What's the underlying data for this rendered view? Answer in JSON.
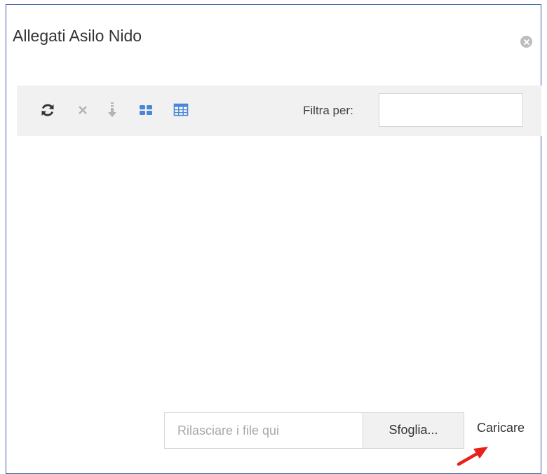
{
  "dialog": {
    "title": "Allegati Asilo Nido",
    "close_icon": "close-circle-icon"
  },
  "toolbar": {
    "icons": [
      "refresh-icon",
      "delete-icon",
      "download-icon",
      "thumbnail-view-icon",
      "grid-view-icon"
    ],
    "filter_label": "Filtra per:",
    "filter_value": ""
  },
  "upload": {
    "dropzone_placeholder": "Rilasciare i file qui",
    "browse_label": "Sfoglia...",
    "upload_label": "Caricare"
  },
  "annotation": {
    "arrow_color": "#e8211c"
  },
  "colors": {
    "dialog_border": "#3b5fa8",
    "toolbar_bg": "#f1f1f1",
    "icon_blue": "#4a86d6"
  }
}
